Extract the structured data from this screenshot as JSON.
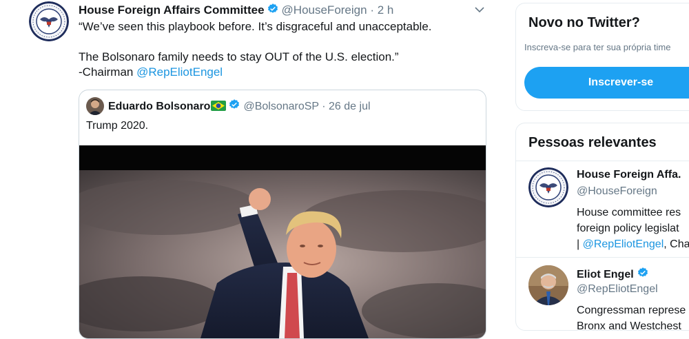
{
  "tweet": {
    "author_name": "House Foreign Affairs Committee",
    "handle": "@HouseForeign",
    "separator": "·",
    "time": "2 h",
    "text": "“We’ve seen this playbook before. It’s disgraceful and unacceptable.\n\nThe Bolsonaro family needs to stay OUT of the U.S. election.”\n-Chairman ",
    "mention": "@RepEliotEngel"
  },
  "quote": {
    "author_name": "Eduardo Bolsonaro",
    "handle": "@BolsonaroSP",
    "separator": "·",
    "date": "26 de jul",
    "text": "Trump 2020."
  },
  "sidebar": {
    "signup": {
      "title": "Novo no Twitter?",
      "subtitle": "Inscreva-se para ter sua própria time",
      "button": "Inscrever-se"
    },
    "relevant": {
      "title": "Pessoas relevantes",
      "people": [
        {
          "name": "House Foreign Affa.",
          "handle": "@HouseForeign",
          "bio": "House committee res\nforeign policy legislat\n| ",
          "bio_mention": "@RepEliotEngel",
          "bio_tail": ", Cha"
        },
        {
          "name": "Eliot Engel",
          "handle": "@RepEliotEngel",
          "bio": "Congressman represe\nBronx and Westchest"
        }
      ]
    }
  },
  "colors": {
    "link": "#1b95e0",
    "button": "#1da1f2",
    "verified": "#1da1f2",
    "border": "#e6ecf0"
  },
  "icons": [
    "verified-badge-icon",
    "chevron-down-icon",
    "brazil-flag-icon",
    "committee-seal-icon"
  ]
}
